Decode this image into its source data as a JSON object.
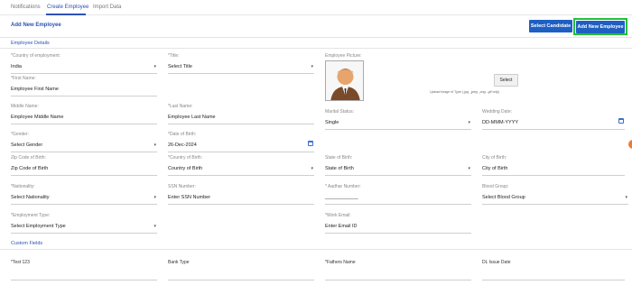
{
  "tabs": [
    {
      "label": "Notifications"
    },
    {
      "label": "Create Employee"
    },
    {
      "label": "Import Data"
    }
  ],
  "header": {
    "title": "Add New Employee",
    "select_candidate_label": "Select Candidate",
    "add_new_employee_label": "Add New Employee"
  },
  "sections": {
    "employee_details": "Employee Details",
    "custom_fields": "Custom Fields"
  },
  "picture": {
    "label": "Employee Picture:",
    "select_label": "Select",
    "hint": "Upload image of Type (.jpg, .jpeg, .png, .gif only)"
  },
  "fields": {
    "country": {
      "label": "*Country of employment:",
      "value": "India"
    },
    "title": {
      "label": "*Title:",
      "value": "Select Title"
    },
    "first_name": {
      "label": "*First Name:",
      "value": "Employee First Name"
    },
    "middle_name": {
      "label": "Middle Name:",
      "value": "Employee Middle Name"
    },
    "last_name": {
      "label": "*Last Name:",
      "value": "Employee Last Name"
    },
    "marital_status": {
      "label": "Marital Status:",
      "value": "Single"
    },
    "wedding_date": {
      "label": "Wedding Date:",
      "value": "DD-MMM-YYYY"
    },
    "gender": {
      "label": "*Gender:",
      "value": "Select Gender"
    },
    "dob": {
      "label": "*Date of Birth:",
      "value": "26-Dec-2024"
    },
    "zip": {
      "label": "Zip Code of Birth:",
      "value": "Zip Code of Birth"
    },
    "country_birth": {
      "label": "*Country of Birth:",
      "value": "Country of Birth"
    },
    "state_birth": {
      "label": "State of Birth:",
      "value": "State of Birth"
    },
    "city_birth": {
      "label": "City of Birth:",
      "value": "City of Birth"
    },
    "nationality": {
      "label": "*Nationality:",
      "value": "Select Nationality"
    },
    "ssn": {
      "label": "SSN Number:",
      "value": "Enter SSN Number"
    },
    "aadhar": {
      "label": "* Aadhar Number:",
      "value": "____________"
    },
    "blood_group": {
      "label": "Blood Group:",
      "value": "Select Blood Group"
    },
    "employment_type": {
      "label": "*Employment Type:",
      "value": "Select Employment Type"
    },
    "work_email": {
      "label": "*Work Email:",
      "value": "Enter Email ID"
    }
  },
  "custom_fields": {
    "test": {
      "label": "*Test 123"
    },
    "bank_type": {
      "label": "Bank Type"
    },
    "fathers_name": {
      "label": "*Fathers Name"
    },
    "dl_issue_date": {
      "label": "DL Issue Date"
    }
  },
  "colors": {
    "accent": "#2a52b4",
    "button": "#1f5fc2",
    "highlight": "#22c03a"
  },
  "icons": {
    "dropdown": "chevron-down-icon",
    "calendar": "calendar-icon",
    "avatar": "person-avatar-icon"
  }
}
